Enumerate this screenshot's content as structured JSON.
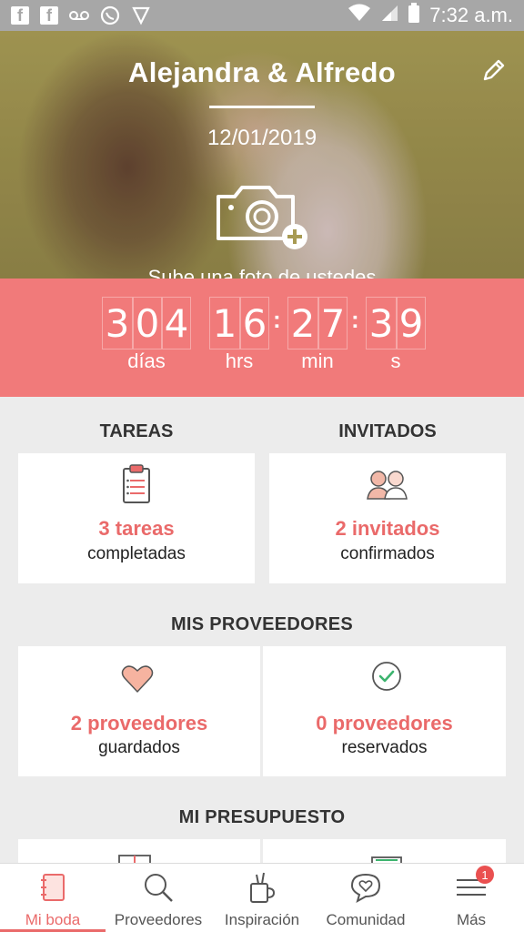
{
  "status_bar": {
    "time": "7:32 a.m."
  },
  "hero": {
    "couple_name": "Alejandra & Alfredo",
    "date": "12/01/2019",
    "upload_text": "Sube una foto de ustedes"
  },
  "countdown": {
    "days": [
      "3",
      "0",
      "4"
    ],
    "hours": [
      "1",
      "6"
    ],
    "minutes": [
      "2",
      "7"
    ],
    "seconds": [
      "3",
      "9"
    ],
    "separator": ":",
    "labels": {
      "days": "días",
      "hours": "hrs",
      "minutes": "min",
      "seconds": "s"
    }
  },
  "tareas": {
    "title": "TAREAS",
    "count": "3 tareas",
    "sub": "completadas"
  },
  "invitados": {
    "title": "INVITADOS",
    "count": "2 invitados",
    "sub": "confirmados"
  },
  "proveedores": {
    "title": "MIS PROVEEDORES",
    "saved": {
      "count": "2 proveedores",
      "sub": "guardados"
    },
    "booked": {
      "count": "0 proveedores",
      "sub": "reservados"
    }
  },
  "presupuesto": {
    "title": "MI PRESUPUESTO"
  },
  "nav": {
    "items": [
      {
        "label": "Mi boda",
        "icon": "notebook-icon",
        "active": true
      },
      {
        "label": "Proveedores",
        "icon": "search-icon",
        "active": false
      },
      {
        "label": "Inspiración",
        "icon": "inspiration-icon",
        "active": false
      },
      {
        "label": "Comunidad",
        "icon": "chat-heart-icon",
        "active": false
      },
      {
        "label": "Más",
        "icon": "menu-icon",
        "active": false
      }
    ],
    "badge": "1"
  },
  "colors": {
    "accent": "#ea6a6a",
    "countdown_bg": "#f17a7a",
    "status_bar": "#a7a7a7"
  }
}
